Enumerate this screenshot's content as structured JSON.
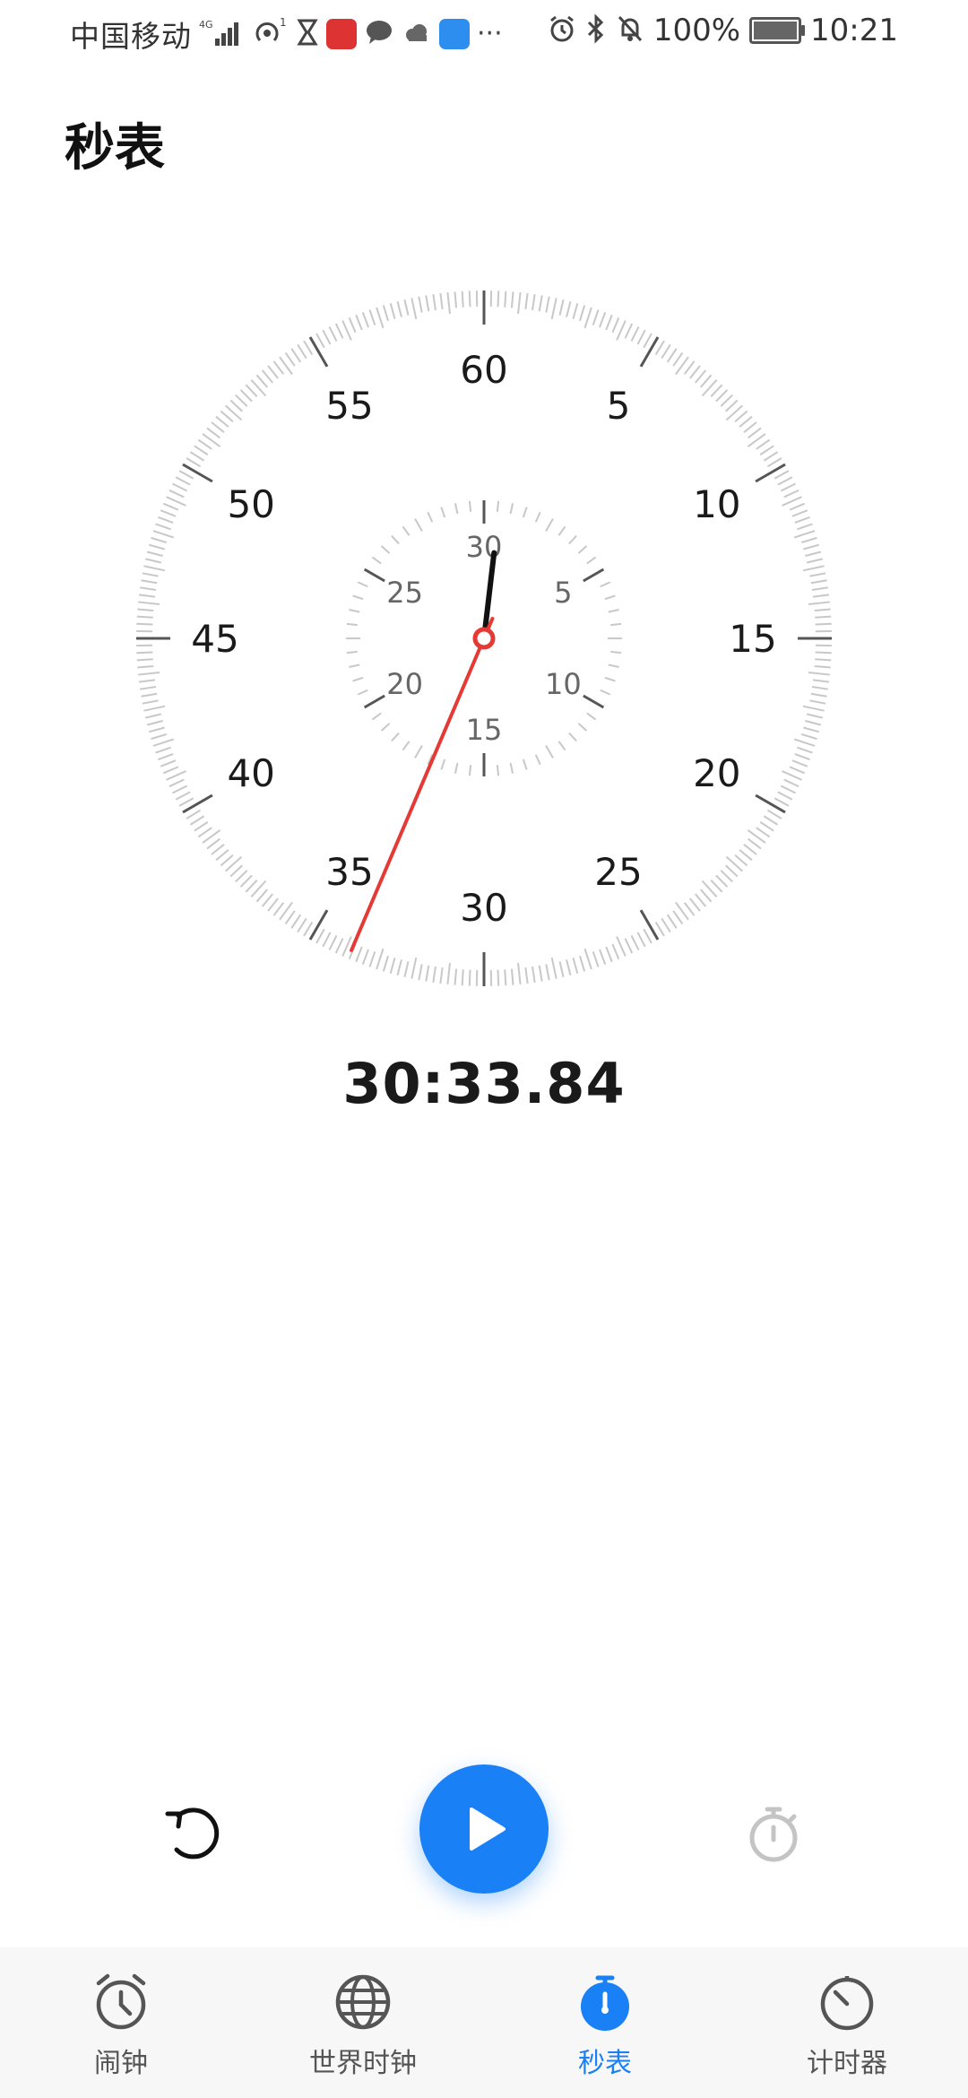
{
  "status_bar": {
    "carrier": "中国移动",
    "network": "4G",
    "hotspot_count": "1",
    "more": "···",
    "battery": "100%",
    "time": "10:21"
  },
  "page": {
    "title": "秒表"
  },
  "dial": {
    "outer_numbers": [
      "60",
      "5",
      "10",
      "15",
      "20",
      "25",
      "30",
      "35",
      "40",
      "45",
      "50",
      "55"
    ],
    "inner_numbers": [
      "30",
      "5",
      "10",
      "15",
      "20",
      "25"
    ],
    "outer_hand_seconds": 33.84,
    "inner_hand_minutes": 30.56
  },
  "stopwatch": {
    "time": "30:33.84"
  },
  "controls": {
    "reset_icon": "reset-icon",
    "play_icon": "play-icon",
    "lap_icon": "lap-stopwatch-icon"
  },
  "nav": {
    "items": [
      {
        "label": "闹钟",
        "icon": "alarm-clock-icon",
        "active": false
      },
      {
        "label": "世界时钟",
        "icon": "globe-icon",
        "active": false
      },
      {
        "label": "秒表",
        "icon": "stopwatch-icon",
        "active": true
      },
      {
        "label": "计时器",
        "icon": "timer-icon",
        "active": false
      }
    ]
  },
  "colors": {
    "accent": "#1a80f5",
    "second_hand": "#e53935",
    "minute_hand": "#111111",
    "tick": "#c8c8c8"
  }
}
